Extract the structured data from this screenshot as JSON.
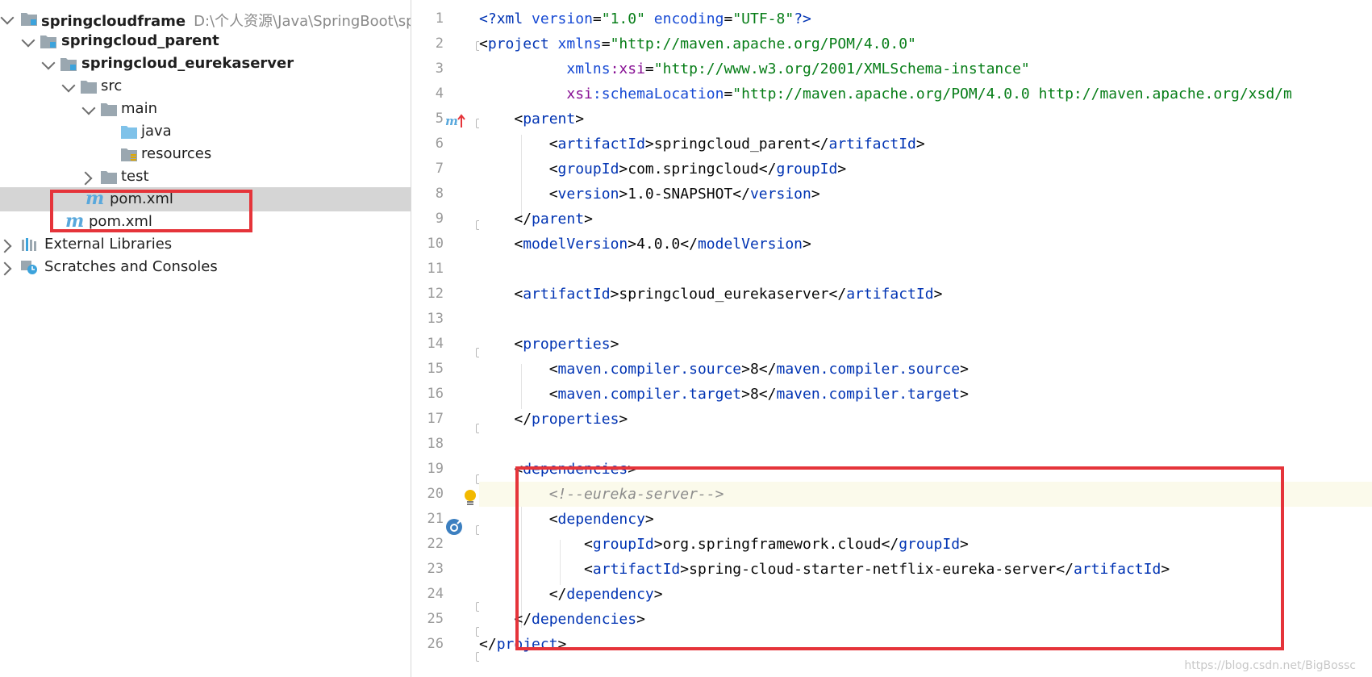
{
  "project_tree": {
    "root": {
      "name": "springcloudframe",
      "path": "D:\\个人资源\\Java\\SpringBoot\\spri"
    },
    "items": [
      {
        "label": "springcloud_parent",
        "bold": true
      },
      {
        "label": "springcloud_eurekaserver",
        "bold": true
      },
      {
        "label": "src"
      },
      {
        "label": "main"
      },
      {
        "label": "java"
      },
      {
        "label": "resources"
      },
      {
        "label": "test"
      },
      {
        "label": "pom.xml",
        "selected": true
      },
      {
        "label": "pom.xml"
      },
      {
        "label": "External Libraries"
      },
      {
        "label": "Scratches and Consoles"
      }
    ]
  },
  "editor": {
    "line_numbers": [
      "1",
      "2",
      "3",
      "4",
      "5",
      "6",
      "7",
      "8",
      "9",
      "10",
      "11",
      "12",
      "13",
      "14",
      "15",
      "16",
      "17",
      "18",
      "19",
      "20",
      "21",
      "22",
      "23",
      "24",
      "25",
      "26"
    ],
    "lines": {
      "l1": {
        "a": "<?",
        "b": "xml ",
        "c": "version",
        "d": "=",
        "e": "\"1.0\"",
        "f": " encoding",
        "g": "=",
        "h": "\"UTF-8\"",
        "i": "?>"
      },
      "l2": {
        "a": "<",
        "b": "project ",
        "c": "xmlns",
        "d": "=",
        "e": "\"http://maven.apache.org/POM/4.0.0\""
      },
      "l3": {
        "a": "xmlns",
        "b": ":xsi",
        "c": "=",
        "d": "\"http://www.w3.org/2001/XMLSchema-instance\""
      },
      "l4": {
        "a": "xsi",
        "b": ":schemaLocation",
        "c": "=",
        "d": "\"http://maven.apache.org/POM/4.0.0 http://maven.apache.org/xsd/m"
      },
      "l5": {
        "a": "<",
        "b": "parent",
        "c": ">"
      },
      "l6": {
        "a": "<",
        "b": "artifactId",
        "c": ">springcloud_parent</",
        "d": "artifactId",
        "e": ">"
      },
      "l7": {
        "a": "<",
        "b": "groupId",
        "c": ">com.springcloud</",
        "d": "groupId",
        "e": ">"
      },
      "l8": {
        "a": "<",
        "b": "version",
        "c": ">1.0-SNAPSHOT</",
        "d": "version",
        "e": ">"
      },
      "l9": {
        "a": "</",
        "b": "parent",
        "c": ">"
      },
      "l10": {
        "a": "<",
        "b": "modelVersion",
        "c": ">4.0.0</",
        "d": "modelVersion",
        "e": ">"
      },
      "l12": {
        "a": "<",
        "b": "artifactId",
        "c": ">springcloud_eurekaserver</",
        "d": "artifactId",
        "e": ">"
      },
      "l14": {
        "a": "<",
        "b": "properties",
        "c": ">"
      },
      "l15": {
        "a": "<",
        "b": "maven.compiler.source",
        "c": ">8</",
        "d": "maven.compiler.source",
        "e": ">"
      },
      "l16": {
        "a": "<",
        "b": "maven.compiler.target",
        "c": ">8</",
        "d": "maven.compiler.target",
        "e": ">"
      },
      "l17": {
        "a": "</",
        "b": "properties",
        "c": ">"
      },
      "l19": {
        "a": "<",
        "b": "dependencies",
        "c": ">"
      },
      "l20": {
        "a": "<!--eureka-server-->"
      },
      "l21": {
        "a": "<",
        "b": "dependency",
        "c": ">"
      },
      "l22": {
        "a": "<",
        "b": "groupId",
        "c": ">org.springframework.cloud</",
        "d": "groupId",
        "e": ">"
      },
      "l23": {
        "a": "<",
        "b": "artifactId",
        "c": ">spring-cloud-starter-netflix-eureka-server</",
        "d": "artifactId",
        "e": ">"
      },
      "l24": {
        "a": "</",
        "b": "dependency",
        "c": ">"
      },
      "l25": {
        "a": "</",
        "b": "dependencies",
        "c": ">"
      },
      "l26": {
        "a": "</",
        "b": "project",
        "c": ">"
      }
    }
  },
  "watermark": "https://blog.csdn.net/BigBossc",
  "colors": {
    "highlight_box": "#e5343a",
    "tag": "#0033b3",
    "string": "#067d17",
    "namespace": "#871094",
    "comment": "#8c8c8c"
  }
}
